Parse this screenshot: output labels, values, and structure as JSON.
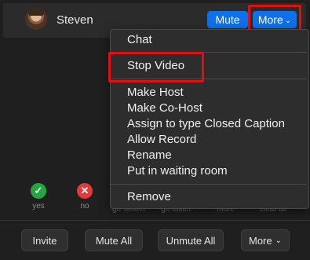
{
  "participant": {
    "name": "Steven",
    "mute_label": "Mute",
    "more_label": "More"
  },
  "menu": {
    "items": [
      "Chat",
      "Stop Video",
      "Make Host",
      "Make Co-Host",
      "Assign to type Closed Caption",
      "Allow Record",
      "Rename",
      "Put in waiting room",
      "Remove"
    ]
  },
  "reactions": {
    "yes_label": "yes",
    "no_label": "no",
    "faded_labels": [
      "go slower",
      "go faster",
      "more",
      "clear all"
    ]
  },
  "footer": {
    "invite": "Invite",
    "mute_all": "Mute All",
    "unmute_all": "Unmute All",
    "more": "More"
  },
  "colors": {
    "accent_blue": "#0e71eb",
    "highlight_red": "#e11010",
    "yes_green": "#23a640",
    "no_red": "#e0393e"
  }
}
